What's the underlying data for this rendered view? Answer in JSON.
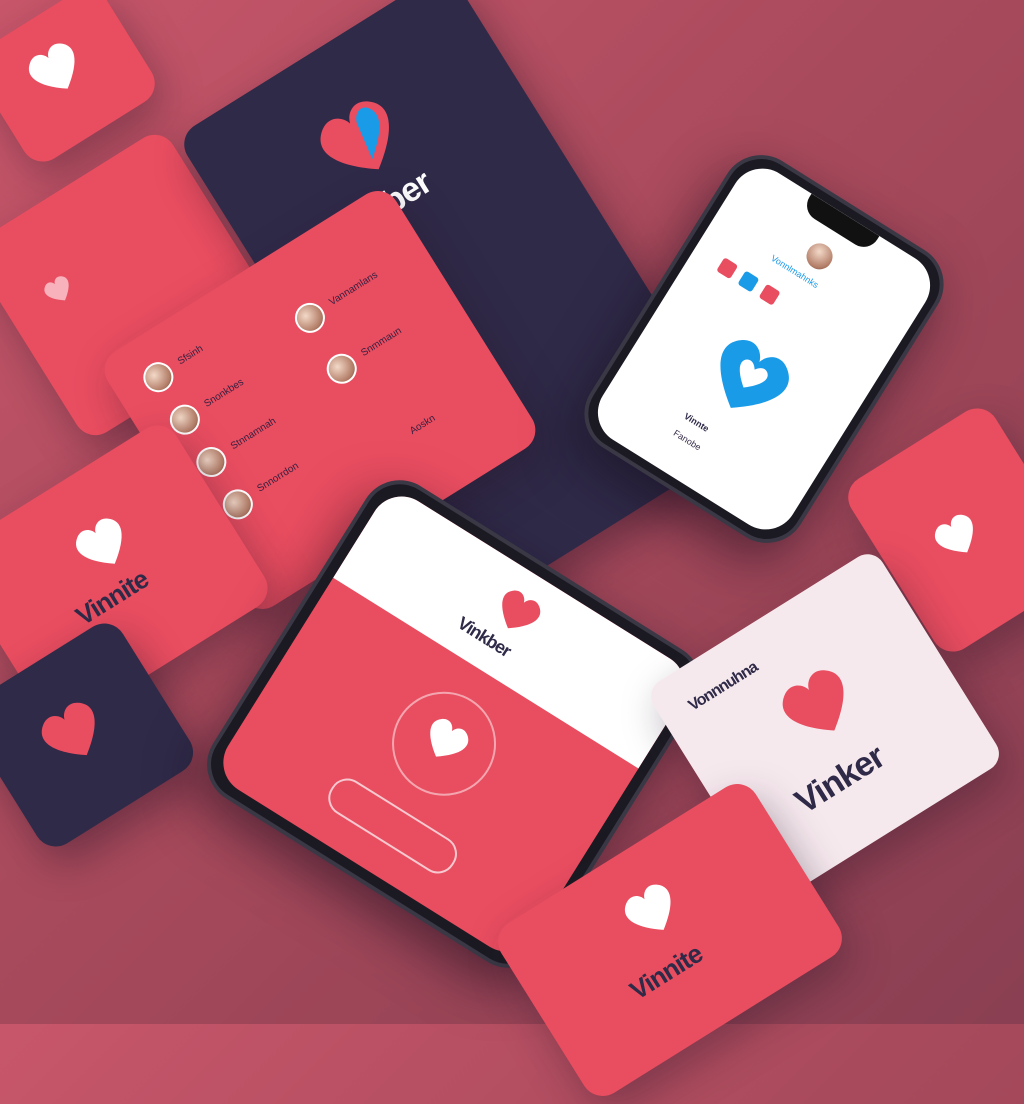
{
  "brand": {
    "wordmark_top": "Vinrber",
    "wordmark_left": "Vinnite",
    "wordmark_white_card": "Vinker",
    "wordmark_white_card_header": "Vonnnuhna",
    "wordmark_phone_center": "Vinkber",
    "wordmark_phone_right": "Vinnte",
    "wordmark_bottom": "Vinnite"
  },
  "chat_list": {
    "rows": [
      {
        "text": "Sfsinh"
      },
      {
        "text": "Snonkbes"
      },
      {
        "text": "Stnnamnah"
      },
      {
        "text": "Snnorrdon"
      },
      {
        "text": "Vannamlans"
      },
      {
        "text": "Snmmaun"
      },
      {
        "text": "Aoskn"
      }
    ]
  },
  "phone_right": {
    "header_text": "Vonnlmahnks",
    "sub_text": "Fanobe"
  },
  "colors": {
    "accent_red": "#e94d60",
    "navy": "#2f2a48",
    "blue": "#1a9be8",
    "background": "#b24e62"
  },
  "icons": {
    "heart": "heart-icon",
    "heart_blue": "heart-blue-icon"
  }
}
